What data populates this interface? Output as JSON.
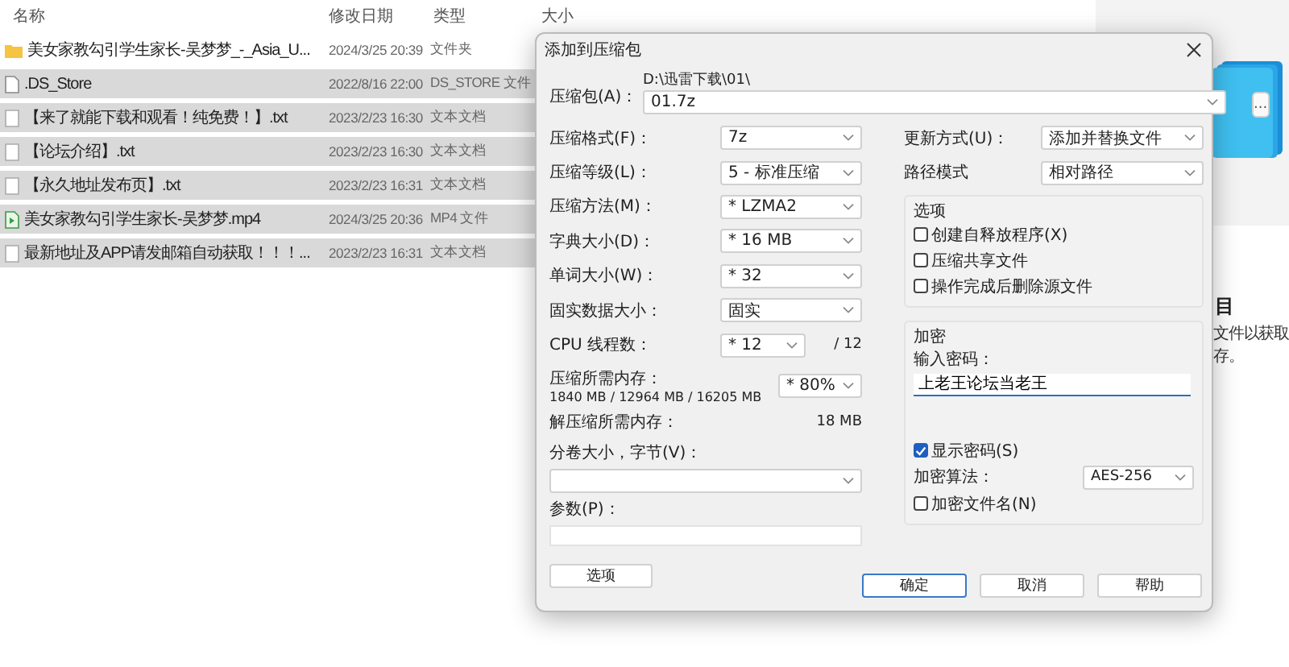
{
  "explorer": {
    "columns": [
      "名称",
      "修改日期",
      "类型",
      "大小"
    ],
    "rows": [
      {
        "kind": "folder",
        "name": "美女家教勾引学生家长-吴梦梦_-_Asia_U...",
        "modified": "2024/3/25 20:39",
        "type": "文件夹",
        "selected": false
      },
      {
        "kind": "document",
        "name": ".DS_Store",
        "modified": "2022/8/16 22:00",
        "type": "DS_STORE 文件",
        "selected": true
      },
      {
        "kind": "text",
        "name": "【来了就能下载和观看！纯免费！】.txt",
        "modified": "2023/2/23 16:30",
        "type": "文本文档",
        "selected": true
      },
      {
        "kind": "text",
        "name": "【论坛介绍】.txt",
        "modified": "2023/2/23 16:30",
        "type": "文本文档",
        "selected": true
      },
      {
        "kind": "text",
        "name": "【永久地址发布页】.txt",
        "modified": "2023/2/23 16:31",
        "type": "文本文档",
        "selected": true
      },
      {
        "kind": "video",
        "name": "美女家教勾引学生家长-吴梦梦.mp4",
        "modified": "2024/3/25 20:36",
        "type": "MP4 文件",
        "selected": true
      },
      {
        "kind": "text",
        "name": "最新地址及APP请发邮箱自动获取！！！...",
        "modified": "2023/2/23 16:31",
        "type": "文本文档",
        "selected": true
      }
    ]
  },
  "details_pane": {
    "heading": "目",
    "lines": [
      "文件以获取",
      "存。"
    ]
  },
  "dialog": {
    "title": "添加到压缩包",
    "archive": {
      "label": "压缩包(A)：",
      "path": "D:\\迅雷下载\\01\\",
      "value": "01.7z",
      "browse_label": "..."
    },
    "left_fields": [
      {
        "kind": "combo",
        "label": "压缩格式(F)：",
        "value": "7z"
      },
      {
        "kind": "combo",
        "label": "压缩等级(L)：",
        "value": "5 - 标准压缩"
      },
      {
        "kind": "combo",
        "label": "压缩方法(M)：",
        "value": "* LZMA2"
      },
      {
        "kind": "combo",
        "label": "字典大小(D)：",
        "value": "* 16 MB"
      },
      {
        "kind": "combo",
        "label": "单词大小(W)：",
        "value": "* 32"
      },
      {
        "kind": "combo",
        "label": "固实数据大小：",
        "value": "固实"
      },
      {
        "kind": "combo_suffix",
        "label": "CPU 线程数：",
        "value": "* 12",
        "suffix": "/ 12"
      },
      {
        "kind": "memory",
        "label": "压缩所需内存：",
        "detail": "1840 MB / 12964 MB / 16205 MB",
        "value": "* 80%"
      },
      {
        "kind": "info",
        "label": "解压缩所需内存：",
        "value": "18 MB"
      },
      {
        "kind": "stacked_combo",
        "label": "分卷大小，字节(V)："
      },
      {
        "kind": "stacked_field",
        "label": "参数(P)："
      }
    ],
    "options_button": "选项",
    "right_combos": [
      {
        "label": "更新方式(U)：",
        "value": "添加并替换文件"
      },
      {
        "label": "路径模式",
        "value": "相对路径"
      }
    ],
    "options_group": {
      "title": "选项",
      "checkboxes": [
        {
          "label": "创建自释放程序(X)",
          "checked": false
        },
        {
          "label": "压缩共享文件",
          "checked": false
        },
        {
          "label": "操作完成后删除源文件",
          "checked": false
        }
      ]
    },
    "encryption": {
      "title": "加密",
      "password_label": "输入密码：",
      "password_value": "上老王论坛当老王",
      "show_password": {
        "label": "显示密码(S)",
        "checked": true
      },
      "algorithm": {
        "label": "加密算法：",
        "value": "AES-256"
      },
      "encrypt_names": {
        "label": "加密文件名(N)",
        "checked": false
      }
    },
    "buttons": [
      {
        "label": "确定",
        "default": true
      },
      {
        "label": "取消",
        "default": false
      },
      {
        "label": "帮助",
        "default": false
      }
    ]
  }
}
